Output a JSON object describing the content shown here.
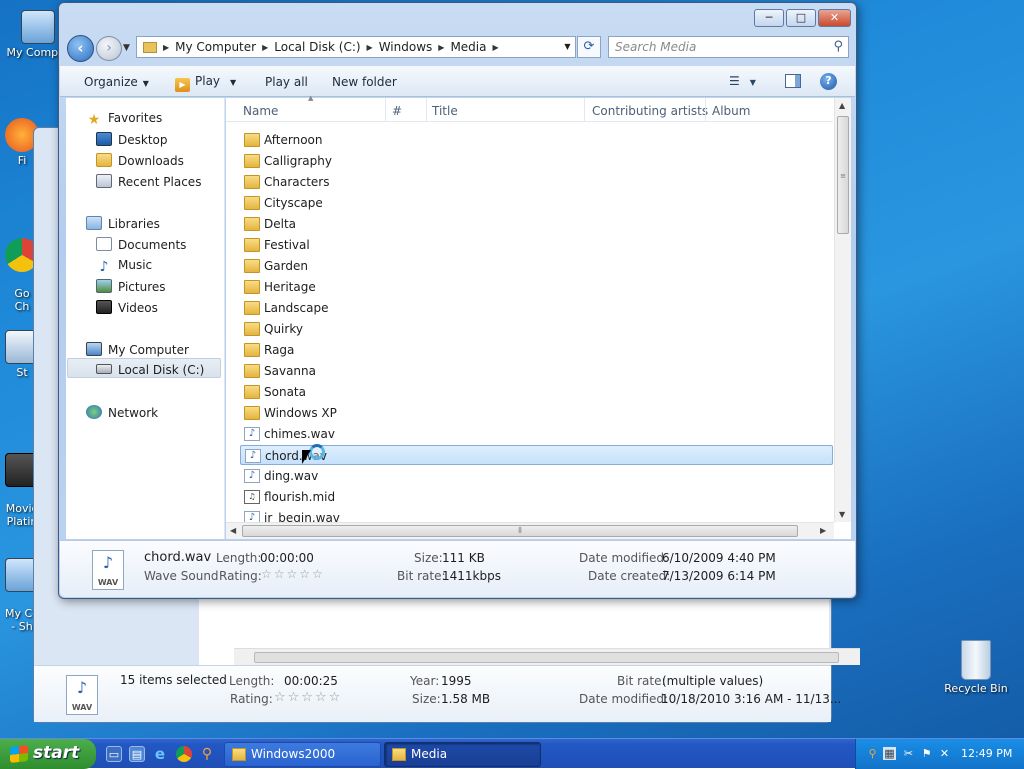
{
  "desktop": {
    "icons": [
      {
        "label": "My Comput"
      },
      {
        "label": "Fi"
      },
      {
        "label": "Go\nCh"
      },
      {
        "label": "St"
      },
      {
        "label": "Movie\nPlatin"
      },
      {
        "label": "My Co\n- Sh"
      },
      {
        "label": "Recycle Bin"
      }
    ]
  },
  "back_window": {
    "details": {
      "count": "15 items selected",
      "length_label": "Length:",
      "length_value": "00:00:25",
      "rating_label": "Rating:",
      "year_label": "Year:",
      "year_value": "1995",
      "size_label": "Size:",
      "size_value": "1.58 MB",
      "bitrate_label": "Bit rate:",
      "bitrate_value": "(multiple values)",
      "modified_label": "Date modified:",
      "modified_value": "10/18/2010 3:16 AM - 11/13...",
      "icon_caption": "WAV"
    }
  },
  "window": {
    "caption_buttons": {
      "min": "─",
      "max": "□",
      "close": "✕"
    },
    "breadcrumb": [
      "My Computer",
      "Local Disk (C:)",
      "Windows",
      "Media"
    ],
    "search_placeholder": "Search Media",
    "toolbar": {
      "organize": "Organize",
      "play": "Play",
      "play_all": "Play all",
      "new_folder": "New folder",
      "help": "?"
    },
    "nav": {
      "favorites": "Favorites",
      "desktop": "Desktop",
      "downloads": "Downloads",
      "recent": "Recent Places",
      "libraries": "Libraries",
      "documents": "Documents",
      "music": "Music",
      "pictures": "Pictures",
      "videos": "Videos",
      "computer": "My Computer",
      "local_disk": "Local Disk (C:)",
      "network": "Network"
    },
    "columns": [
      "Name",
      "#",
      "Title",
      "Contributing artists",
      "Album"
    ],
    "files": [
      {
        "name": "Afternoon",
        "type": "folder"
      },
      {
        "name": "Calligraphy",
        "type": "folder"
      },
      {
        "name": "Characters",
        "type": "folder"
      },
      {
        "name": "Cityscape",
        "type": "folder"
      },
      {
        "name": "Delta",
        "type": "folder"
      },
      {
        "name": "Festival",
        "type": "folder"
      },
      {
        "name": "Garden",
        "type": "folder"
      },
      {
        "name": "Heritage",
        "type": "folder"
      },
      {
        "name": "Landscape",
        "type": "folder"
      },
      {
        "name": "Quirky",
        "type": "folder"
      },
      {
        "name": "Raga",
        "type": "folder"
      },
      {
        "name": "Savanna",
        "type": "folder"
      },
      {
        "name": "Sonata",
        "type": "folder"
      },
      {
        "name": "Windows XP",
        "type": "folder"
      },
      {
        "name": "chimes.wav",
        "type": "wav"
      },
      {
        "name": "chord.wav",
        "type": "wav",
        "selected": true
      },
      {
        "name": "ding.wav",
        "type": "wav"
      },
      {
        "name": "flourish.mid",
        "type": "mid"
      },
      {
        "name": "ir_begin.wav",
        "type": "wav"
      }
    ],
    "details": {
      "name": "chord.wav",
      "type": "Wave Sound",
      "length_label": "Length:",
      "length_value": "00:00:00",
      "rating_label": "Rating:",
      "size_label": "Size:",
      "size_value": "111 KB",
      "bitrate_label": "Bit rate:",
      "bitrate_value": "1411kbps",
      "modified_label": "Date modified:",
      "modified_value": "6/10/2009 4:40 PM",
      "created_label": "Date created:",
      "created_value": "7/13/2009 6:14 PM",
      "icon_caption": "WAV"
    }
  },
  "taskbar": {
    "start": "start",
    "tasks": [
      "Windows2000",
      "Media"
    ],
    "clock": "12:49 PM"
  },
  "colors": {
    "selection": "#c5e1fb",
    "taskbar": "#2257c4",
    "start": "#2f8d2e"
  }
}
